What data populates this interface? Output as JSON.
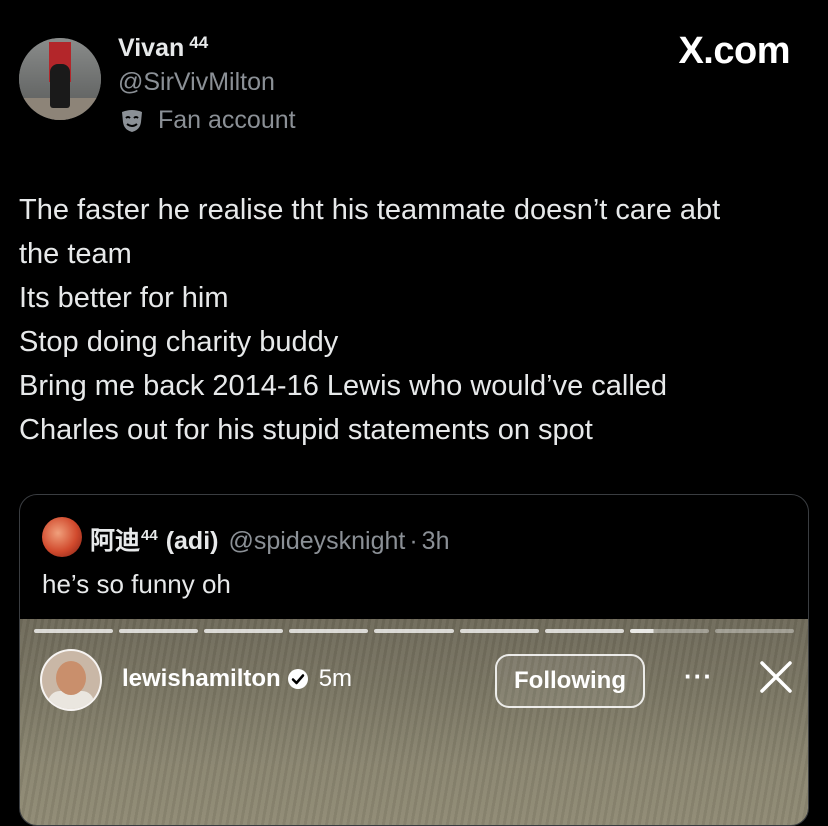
{
  "author": {
    "name": "Vivan",
    "name_superscript": "44",
    "handle": "@SirVivMilton",
    "badge_label": "Fan account",
    "badge_icon": "theater-mask-icon"
  },
  "brand": "X.com",
  "tweet": {
    "lines": [
      "The faster he realise tht his teammate doesn’t care abt",
      "the team",
      "Its better for him",
      "Stop doing charity buddy",
      "Bring me back 2014-16 Lewis who would’ve called",
      "Charles out for his stupid statements on spot"
    ]
  },
  "quote": {
    "name": "阿迪",
    "name_superscript": "44",
    "name_suffix": "(adi)",
    "handle": "@spideysknight",
    "separator": "·",
    "time": "3h",
    "text": "he’s so funny oh",
    "story": {
      "username": "lewishamilton",
      "verified": true,
      "time": "5m",
      "follow_label": "Following",
      "more_label": "···",
      "close_icon": "close-icon",
      "segments": [
        "full",
        "full",
        "full",
        "full",
        "full",
        "full",
        "full",
        "partial",
        "off"
      ]
    }
  },
  "colors": {
    "background": "#000000",
    "text": "#e7e9ea",
    "muted": "#8b9096",
    "border": "#3a3d41"
  }
}
